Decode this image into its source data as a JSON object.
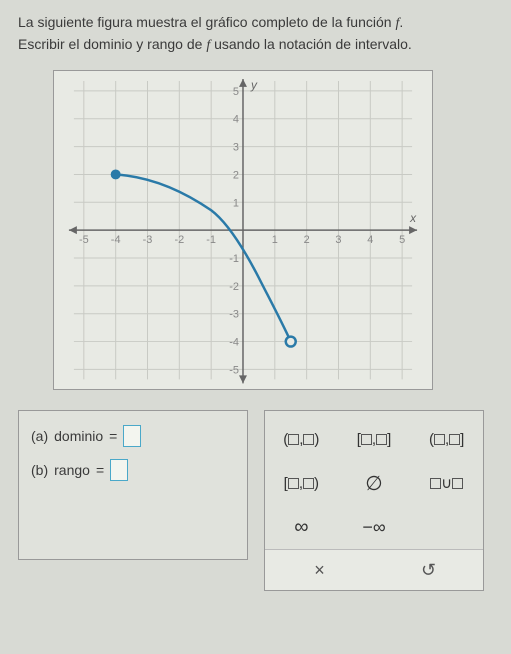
{
  "prompt": {
    "line1_a": "La siguiente figura muestra el gráfico completo de la función ",
    "line1_f": "f",
    "line1_b": ".",
    "line2_a": "Escribir el dominio y rango de ",
    "line2_f": "f",
    "line2_b": " usando la notación de intervalo."
  },
  "chart_data": {
    "type": "line",
    "title": "",
    "xlabel": "x",
    "ylabel": "y",
    "xlim": [
      -5,
      5
    ],
    "ylim": [
      -5,
      5
    ],
    "x_ticks": [
      -5,
      -4,
      -3,
      -2,
      -1,
      1,
      2,
      3,
      4,
      5
    ],
    "y_ticks": [
      -5,
      -4,
      -3,
      -2,
      -1,
      1,
      2,
      3,
      4,
      5
    ],
    "series": [
      {
        "name": "f",
        "points": [
          {
            "x": -4,
            "y": 2,
            "endpoint": "closed"
          },
          {
            "x": -3,
            "y": 1.9
          },
          {
            "x": -2,
            "y": 1.5
          },
          {
            "x": -1,
            "y": 0.7
          },
          {
            "x": 0,
            "y": -0.6
          },
          {
            "x": 0.5,
            "y": -1.7
          },
          {
            "x": 1,
            "y": -2.9
          },
          {
            "x": 1.5,
            "y": -4,
            "endpoint": "open"
          }
        ]
      }
    ]
  },
  "answers": {
    "a_label": "(a)",
    "a_text": "dominio",
    "eq": "=",
    "b_label": "(b)",
    "b_text": "rango"
  },
  "palette": {
    "open_open": "(□,□)",
    "closed_closed": "[□,□]",
    "open_closed": "(□,□]",
    "closed_open": "[□,□)",
    "empty": "∅",
    "union": "□∪□",
    "inf": "∞",
    "neg_inf": "−∞",
    "clear": "×",
    "reset": "↺"
  }
}
